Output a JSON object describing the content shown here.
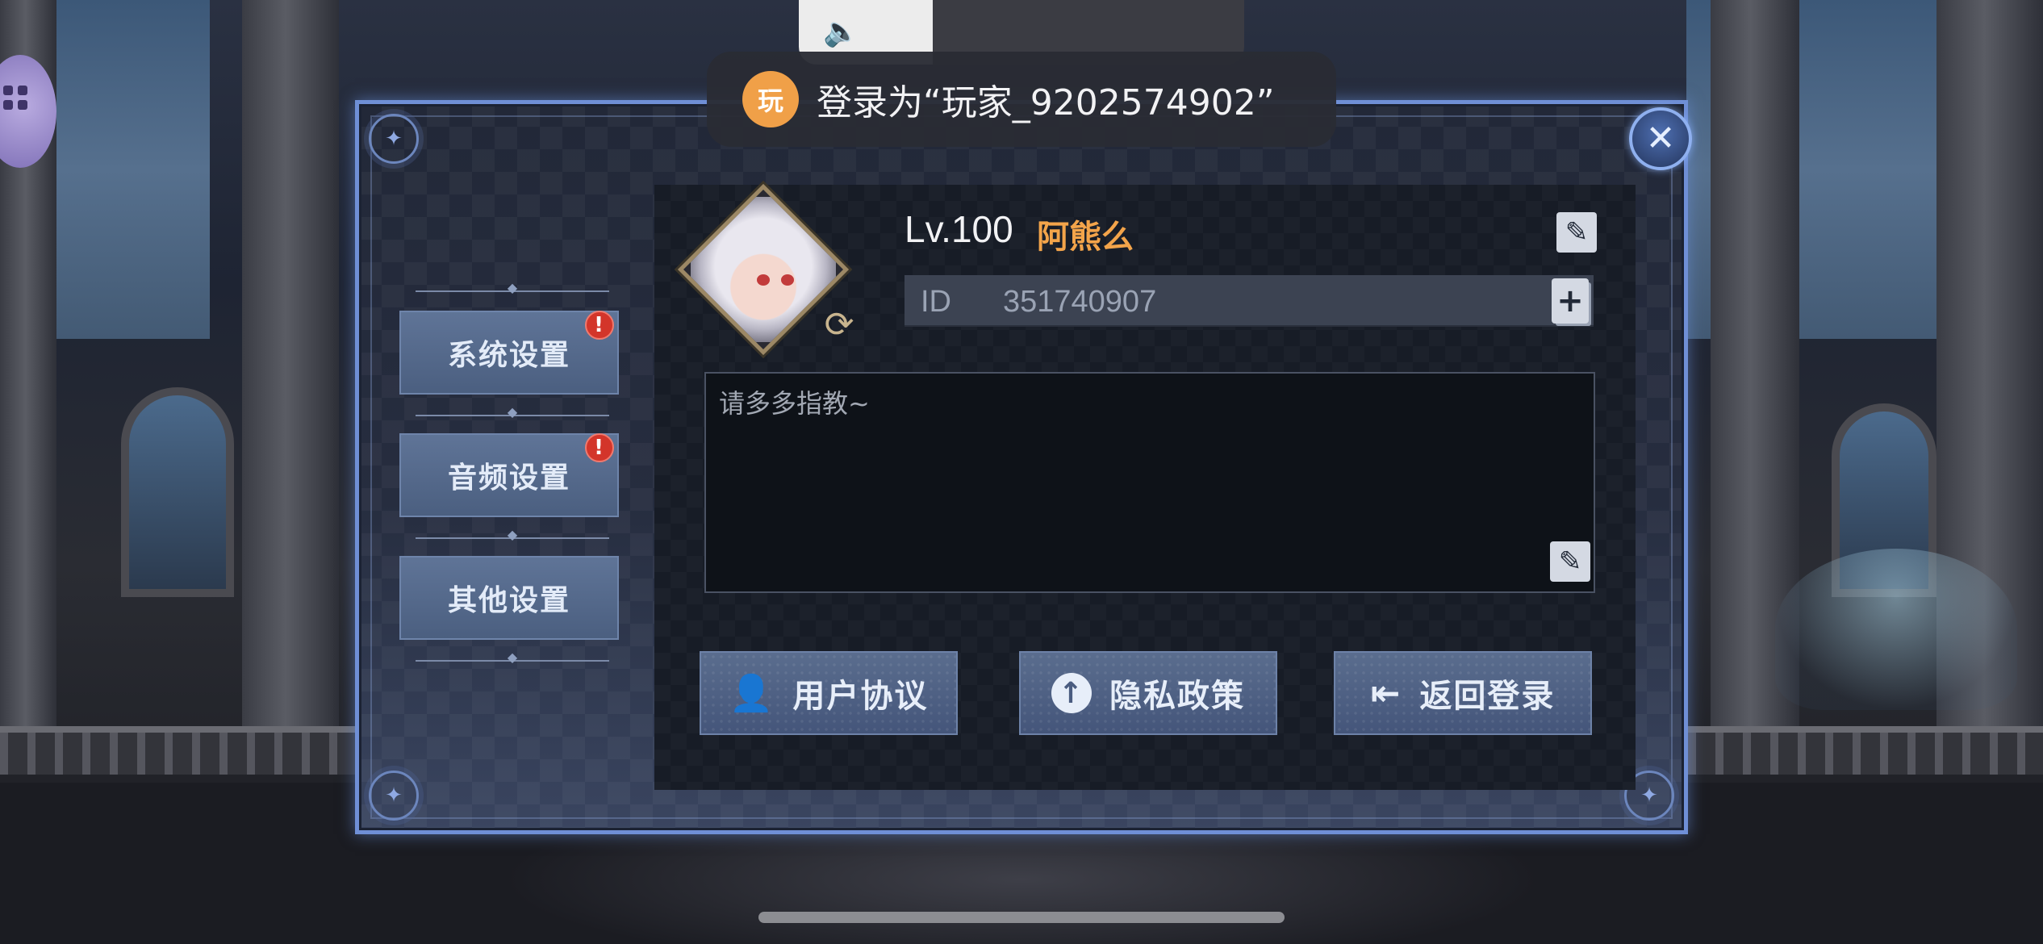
{
  "system": {
    "volume_level": 0.3,
    "toast_avatar_char": "玩",
    "toast_text": "登录为“玩家_9202574902”"
  },
  "settings_menu": {
    "items": [
      {
        "label": "系统设置",
        "has_alert": true
      },
      {
        "label": "音频设置",
        "has_alert": true
      },
      {
        "label": "其他设置",
        "has_alert": false
      }
    ],
    "alert_symbol": "!"
  },
  "profile": {
    "level": "Lv.100",
    "name": "阿熊么",
    "id_label": "ID",
    "id_value": "351740907",
    "signature": "请多多指教~"
  },
  "actions": {
    "user_agreement": "用户协议",
    "privacy_policy": "隐私政策",
    "back_to_login": "返回登录"
  },
  "icons": {
    "close": "close-icon",
    "edit": "edit-icon",
    "copy": "copy-icon",
    "refresh": "refresh-icon",
    "user": "user-icon",
    "upload": "upload-icon",
    "logout": "logout-icon",
    "speaker": "speaker-icon"
  },
  "colors": {
    "dialog_border": "#6f8fd6",
    "name_accent": "#f3a44a",
    "alert_red": "#d3352a",
    "toast_avatar": "#f0a048"
  }
}
